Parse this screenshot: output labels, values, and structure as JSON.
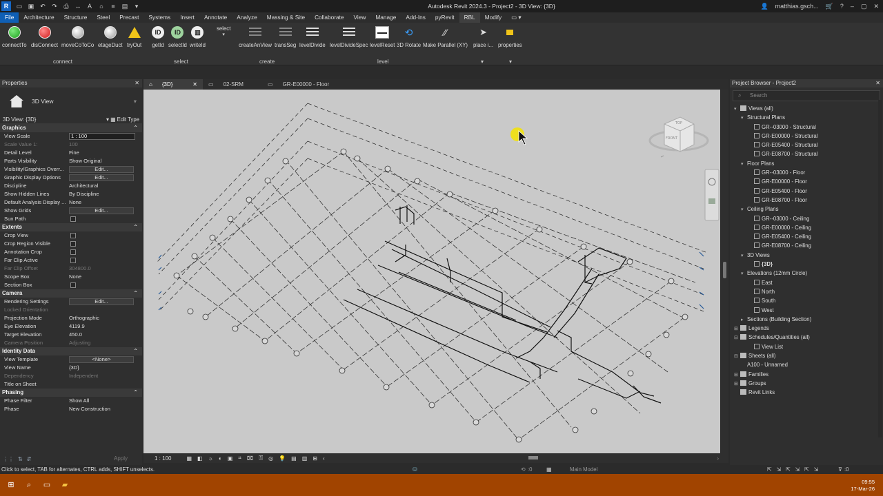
{
  "window": {
    "title": "Autodesk Revit 2024.3 - Project2 - 3D View: {3D}",
    "user": "matthias.gsch...",
    "app_logo": "R"
  },
  "menu": [
    {
      "label": "File"
    },
    {
      "label": "Architecture"
    },
    {
      "label": "Structure"
    },
    {
      "label": "Steel"
    },
    {
      "label": "Precast"
    },
    {
      "label": "Systems"
    },
    {
      "label": "Insert"
    },
    {
      "label": "Annotate"
    },
    {
      "label": "Analyze"
    },
    {
      "label": "Massing & Site"
    },
    {
      "label": "Collaborate"
    },
    {
      "label": "View"
    },
    {
      "label": "Manage"
    },
    {
      "label": "Add-Ins"
    },
    {
      "label": "pyRevit"
    },
    {
      "label": "RBL"
    },
    {
      "label": "Modify"
    }
  ],
  "ribbon": {
    "tools": [
      {
        "label": "connectTo",
        "icon": "green-dot-icon"
      },
      {
        "label": "disConnect",
        "icon": "red-dot-icon"
      },
      {
        "label": "moveCoToCo",
        "icon": "wrench-icon"
      },
      {
        "label": "etageDuct",
        "icon": "wrench-icon"
      },
      {
        "label": "tryOut",
        "icon": "warning-icon"
      },
      {
        "label": "getId",
        "icon": "id-icon"
      },
      {
        "label": "selectId",
        "icon": "id-select-icon"
      },
      {
        "label": "writeId",
        "icon": "id-write-icon"
      },
      {
        "label": "select",
        "icon": "select-icon"
      },
      {
        "label": "createAnView",
        "icon": "view-icon"
      },
      {
        "label": "transSeg",
        "icon": "segment-icon"
      },
      {
        "label": "levelDivide",
        "icon": "list-icon"
      },
      {
        "label": "levelDivideSpec",
        "icon": "list-icon"
      },
      {
        "label": "levelReset",
        "icon": "level-reset-icon"
      },
      {
        "label": "3D Rotate",
        "icon": "rotate-icon"
      },
      {
        "label": "Make Parallel (XY)",
        "icon": "parallel-icon"
      },
      {
        "label": "place i...",
        "icon": "cursor-icon"
      },
      {
        "label": "properties",
        "icon": "properties-icon"
      }
    ],
    "panels": [
      {
        "label": "connect"
      },
      {
        "label": "select"
      },
      {
        "label": "create"
      },
      {
        "label": "level"
      }
    ]
  },
  "properties": {
    "title": "Properties",
    "type_name": "3D View",
    "instance": "3D View: {3D}",
    "edit_type": "Edit Type",
    "groups": [
      {
        "name": "Graphics",
        "rows": [
          {
            "k": "View Scale",
            "v": "1 : 100",
            "kind": "input"
          },
          {
            "k": "Scale Value    1:",
            "v": "100",
            "dim": true
          },
          {
            "k": "Detail Level",
            "v": "Fine"
          },
          {
            "k": "Parts Visibility",
            "v": "Show Original"
          },
          {
            "k": "Visibility/Graphics Overr...",
            "v": "Edit...",
            "kind": "button"
          },
          {
            "k": "Graphic Display Options",
            "v": "Edit...",
            "kind": "button"
          },
          {
            "k": "Discipline",
            "v": "Architectural"
          },
          {
            "k": "Show Hidden Lines",
            "v": "By Discipline"
          },
          {
            "k": "Default Analysis Display ...",
            "v": "None"
          },
          {
            "k": "Show Grids",
            "v": "Edit...",
            "kind": "button"
          },
          {
            "k": "Sun Path",
            "v": "",
            "kind": "check"
          }
        ]
      },
      {
        "name": "Extents",
        "rows": [
          {
            "k": "Crop View",
            "v": "",
            "kind": "check"
          },
          {
            "k": "Crop Region Visible",
            "v": "",
            "kind": "check"
          },
          {
            "k": "Annotation Crop",
            "v": "",
            "kind": "check"
          },
          {
            "k": "Far Clip Active",
            "v": "",
            "kind": "check"
          },
          {
            "k": "Far Clip Offset",
            "v": "304800.0",
            "dim": true
          },
          {
            "k": "Scope Box",
            "v": "None"
          },
          {
            "k": "Section Box",
            "v": "",
            "kind": "check"
          }
        ]
      },
      {
        "name": "Camera",
        "rows": [
          {
            "k": "Rendering Settings",
            "v": "Edit...",
            "kind": "button"
          },
          {
            "k": "Locked Orientation",
            "v": "",
            "dim": true
          },
          {
            "k": "Projection Mode",
            "v": "Orthographic"
          },
          {
            "k": "Eye Elevation",
            "v": "4119.9"
          },
          {
            "k": "Target Elevation",
            "v": "450.0"
          },
          {
            "k": "Camera Position",
            "v": "Adjusting",
            "dim": true
          }
        ]
      },
      {
        "name": "Identity Data",
        "rows": [
          {
            "k": "View Template",
            "v": "<None>",
            "kind": "button"
          },
          {
            "k": "View Name",
            "v": "{3D}"
          },
          {
            "k": "Dependency",
            "v": "Independent",
            "dim": true
          },
          {
            "k": "Title on Sheet",
            "v": ""
          }
        ]
      },
      {
        "name": "Phasing",
        "rows": [
          {
            "k": "Phase Filter",
            "v": "Show All"
          },
          {
            "k": "Phase",
            "v": "New Construction"
          }
        ]
      }
    ],
    "apply": "Apply"
  },
  "tabs": [
    {
      "label": "{3D}",
      "active": true
    },
    {
      "label": "02-SRM"
    },
    {
      "label": "GR-E00000 - Floor"
    }
  ],
  "view_bar": {
    "scale": "1 : 100"
  },
  "view_cube": {
    "top": "TOP",
    "front": "FRONT"
  },
  "browser": {
    "title": "Project Browser - Project2",
    "search_placeholder": "Search",
    "nodes": [
      {
        "label": "Views (all)",
        "level": 0,
        "toggle": "▾",
        "icon": "group"
      },
      {
        "label": "Structural Plans",
        "level": 1,
        "toggle": "▾"
      },
      {
        "label": "GR--03000 - Structural",
        "level": 2,
        "icon": "leaf"
      },
      {
        "label": "GR-E00000 - Structural",
        "level": 2,
        "icon": "leaf"
      },
      {
        "label": "GR-E05400 - Structural",
        "level": 2,
        "icon": "leaf"
      },
      {
        "label": "GR-E08700 - Structural",
        "level": 2,
        "icon": "leaf"
      },
      {
        "label": "Floor Plans",
        "level": 1,
        "toggle": "▾"
      },
      {
        "label": "GR--03000 - Floor",
        "level": 2,
        "icon": "leaf"
      },
      {
        "label": "GR-E00000 - Floor",
        "level": 2,
        "icon": "leaf"
      },
      {
        "label": "GR-E05400 - Floor",
        "level": 2,
        "icon": "leaf"
      },
      {
        "label": "GR-E08700 - Floor",
        "level": 2,
        "icon": "leaf"
      },
      {
        "label": "Ceiling Plans",
        "level": 1,
        "toggle": "▾"
      },
      {
        "label": "GR--03000 - Ceiling",
        "level": 2,
        "icon": "leaf"
      },
      {
        "label": "GR-E00000 - Ceiling",
        "level": 2,
        "icon": "leaf"
      },
      {
        "label": "GR-E05400 - Ceiling",
        "level": 2,
        "icon": "leaf"
      },
      {
        "label": "GR-E08700 - Ceiling",
        "level": 2,
        "icon": "leaf"
      },
      {
        "label": "3D Views",
        "level": 1,
        "toggle": "▾"
      },
      {
        "label": "{3D}",
        "level": 2,
        "icon": "leaf",
        "bold": true
      },
      {
        "label": "Elevations (12mm Circle)",
        "level": 1,
        "toggle": "▾"
      },
      {
        "label": "East",
        "level": 2,
        "icon": "leaf"
      },
      {
        "label": "North",
        "level": 2,
        "icon": "leaf"
      },
      {
        "label": "South",
        "level": 2,
        "icon": "leaf"
      },
      {
        "label": "West",
        "level": 2,
        "icon": "leaf"
      },
      {
        "label": "Sections (Building Section)",
        "level": 1,
        "toggle": "▸"
      },
      {
        "label": "Legends",
        "level": 0,
        "toggle": "⊞",
        "icon": "group"
      },
      {
        "label": "Schedules/Quantities (all)",
        "level": 0,
        "toggle": "⊟",
        "icon": "group"
      },
      {
        "label": "View List",
        "level": 2,
        "icon": "leaf"
      },
      {
        "label": "Sheets (all)",
        "level": 0,
        "toggle": "⊟",
        "icon": "group"
      },
      {
        "label": "A100 - Unnamed",
        "level": 1
      },
      {
        "label": "Families",
        "level": 0,
        "toggle": "⊞",
        "icon": "group"
      },
      {
        "label": "Groups",
        "level": 0,
        "toggle": "⊞",
        "icon": "group"
      },
      {
        "label": "Revit Links",
        "level": 0,
        "icon": "group"
      }
    ]
  },
  "status": {
    "hint": "Click to select, TAB for alternates, CTRL adds, SHIFT unselects.",
    "coord": ":0",
    "model": "Main Model",
    "filter_count": ":0"
  },
  "taskbar": {
    "time": "09:55",
    "date": "17-Mar-26"
  },
  "colors": {
    "accent": "#0f5fb5",
    "taskbar": "#a14400",
    "viewport_bg": "#c9c9c9"
  }
}
